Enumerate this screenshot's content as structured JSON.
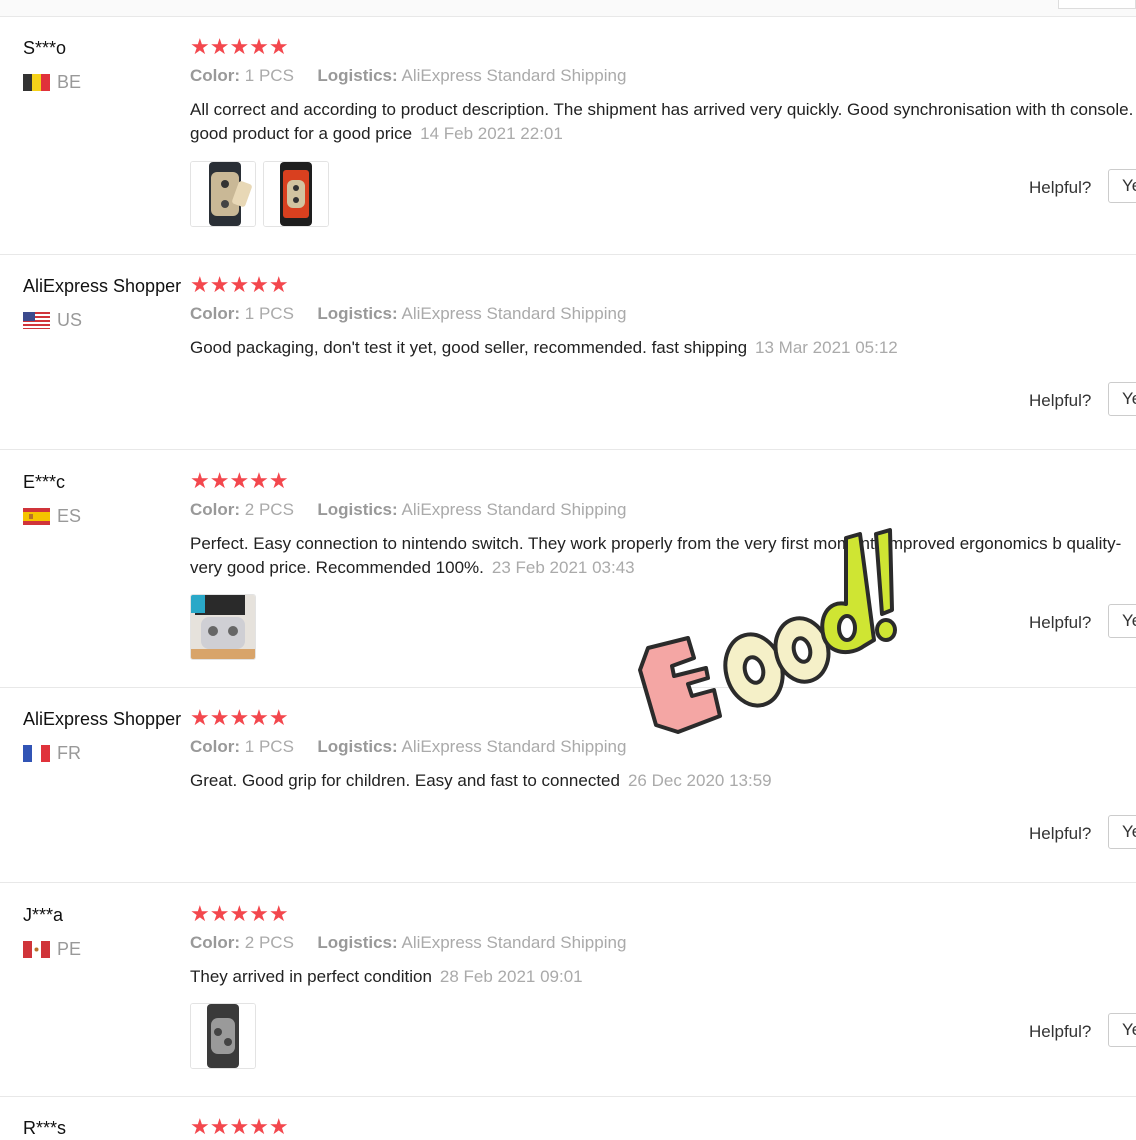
{
  "colors": {
    "star": "#f3474d",
    "muted": "#999999",
    "border": "#e8e8e8"
  },
  "reviews": [
    {
      "name": "S***o",
      "country": "BE",
      "stars": "★★★★★",
      "color_label": "Color:",
      "color_value": "1 PCS",
      "logistics_label": "Logistics:",
      "logistics_value": "AliExpress Standard Shipping",
      "text": "All correct and according to product description. The shipment has arrived very quickly. Good synchronisation with th console. A good product for a good price",
      "date": "14 Feb 2021 22:01",
      "helpful": "Helpful?",
      "yes": "Yes"
    },
    {
      "name": "AliExpress Shopper",
      "country": "US",
      "stars": "★★★★★",
      "color_label": "Color:",
      "color_value": "1 PCS",
      "logistics_label": "Logistics:",
      "logistics_value": "AliExpress Standard Shipping",
      "text": "Good packaging, don't test it yet, good seller, recommended. fast shipping",
      "date": "13 Mar 2021 05:12",
      "helpful": "Helpful?",
      "yes": "Yes"
    },
    {
      "name": "E***c",
      "country": "ES",
      "stars": "★★★★★",
      "color_label": "Color:",
      "color_value": "2 PCS",
      "logistics_label": "Logistics:",
      "logistics_value": "AliExpress Standard Shipping",
      "text": "Perfect. Easy connection to nintendo switch. They work properly from the very first moment. Improved ergonomics b quality-very good price. Recommended 100%.",
      "date": "23 Feb 2021 03:43",
      "helpful": "Helpful?",
      "yes": "Yes"
    },
    {
      "name": "AliExpress Shopper",
      "country": "FR",
      "stars": "★★★★★",
      "color_label": "Color:",
      "color_value": "1 PCS",
      "logistics_label": "Logistics:",
      "logistics_value": "AliExpress Standard Shipping",
      "text": "Great. Good grip for children. Easy and fast to connected",
      "date": "26 Dec 2020 13:59",
      "helpful": "Helpful?",
      "yes": "Yes"
    },
    {
      "name": "J***a",
      "country": "PE",
      "stars": "★★★★★",
      "color_label": "Color:",
      "color_value": "2 PCS",
      "logistics_label": "Logistics:",
      "logistics_value": "AliExpress Standard Shipping",
      "text": "They arrived in perfect condition",
      "date": "28 Feb 2021 09:01",
      "helpful": "Helpful?",
      "yes": "Yes"
    },
    {
      "name": "R***s",
      "stars": "★★★★★"
    }
  ],
  "sticker": {
    "text": "Good!"
  }
}
